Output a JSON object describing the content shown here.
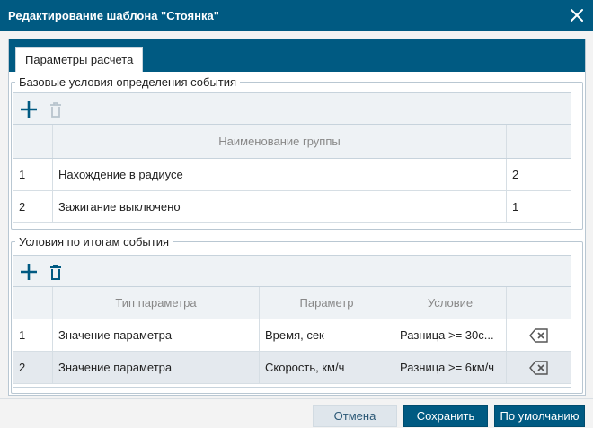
{
  "dialog": {
    "title": "Редактирование шаблона \"Стоянка\"",
    "close_icon": "close-icon"
  },
  "tabs": [
    {
      "label": "Параметры расчета",
      "active": true
    }
  ],
  "base_conditions": {
    "legend": "Базовые условия определения события",
    "toolbar": {
      "add_icon": "plus-icon",
      "delete_icon": "trash-icon",
      "delete_enabled": false
    },
    "columns": [
      "",
      "Наименование группы",
      ""
    ],
    "rows": [
      {
        "index": "1",
        "name": "Нахождение в радиусе",
        "count": "2"
      },
      {
        "index": "2",
        "name": "Зажигание выключено",
        "count": "1"
      }
    ]
  },
  "result_conditions": {
    "legend": "Условия по итогам события",
    "toolbar": {
      "add_icon": "plus-icon",
      "delete_icon": "trash-icon",
      "delete_enabled": true
    },
    "columns": [
      "",
      "Тип параметра",
      "Параметр",
      "Условие",
      ""
    ],
    "rows": [
      {
        "index": "1",
        "type": "Значение параметра",
        "param": "Время, сек",
        "condition": "Разница >= 30с...",
        "action_icon": "backspace-icon"
      },
      {
        "index": "2",
        "type": "Значение параметра",
        "param": "Скорость, км/ч",
        "condition": "Разница >= 6км/ч",
        "action_icon": "backspace-icon",
        "selected": true
      }
    ]
  },
  "footer": {
    "cancel_label": "Отмена",
    "save_label": "Сохранить",
    "default_label": "По умолчанию"
  },
  "colors": {
    "primary": "#005a82",
    "header_bg": "#eef2f5",
    "selected_row": "#e4e9ee"
  }
}
